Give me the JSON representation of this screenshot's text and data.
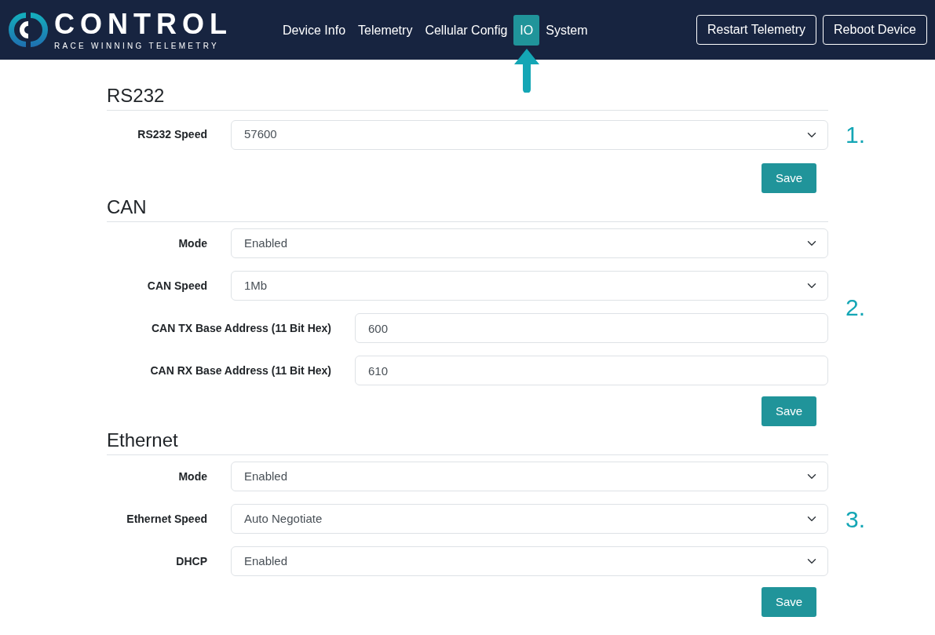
{
  "brand": {
    "name": "CONTROL",
    "tagline": "RACE WINNING TELEMETRY"
  },
  "nav": [
    {
      "label": "Device Info",
      "selected": false
    },
    {
      "label": "Telemetry",
      "selected": false
    },
    {
      "label": "Cellular Config",
      "selected": false
    },
    {
      "label": "IO",
      "selected": true
    },
    {
      "label": "System",
      "selected": false
    }
  ],
  "header_buttons": [
    "Restart Telemetry",
    "Reboot Device"
  ],
  "sections": [
    {
      "title": "RS232",
      "annotation": "1.",
      "fields": [
        {
          "kind": "select",
          "label": "RS232 Speed",
          "value": "57600"
        }
      ],
      "save": "Save"
    },
    {
      "title": "CAN",
      "annotation": "2.",
      "fields": [
        {
          "kind": "select",
          "label": "Mode",
          "value": "Enabled"
        },
        {
          "kind": "select",
          "label": "CAN Speed",
          "value": "1Mb"
        },
        {
          "kind": "input",
          "label": "CAN TX Base Address (11 Bit Hex)",
          "value": "600"
        },
        {
          "kind": "input",
          "label": "CAN RX Base Address (11 Bit Hex)",
          "value": "610"
        }
      ],
      "save": "Save"
    },
    {
      "title": "Ethernet",
      "annotation": "3.",
      "fields": [
        {
          "kind": "select",
          "label": "Mode",
          "value": "Enabled"
        },
        {
          "kind": "select",
          "label": "Ethernet Speed",
          "value": "Auto Negotiate"
        },
        {
          "kind": "select",
          "label": "DHCP",
          "value": "Enabled"
        }
      ],
      "save": "Save"
    }
  ]
}
